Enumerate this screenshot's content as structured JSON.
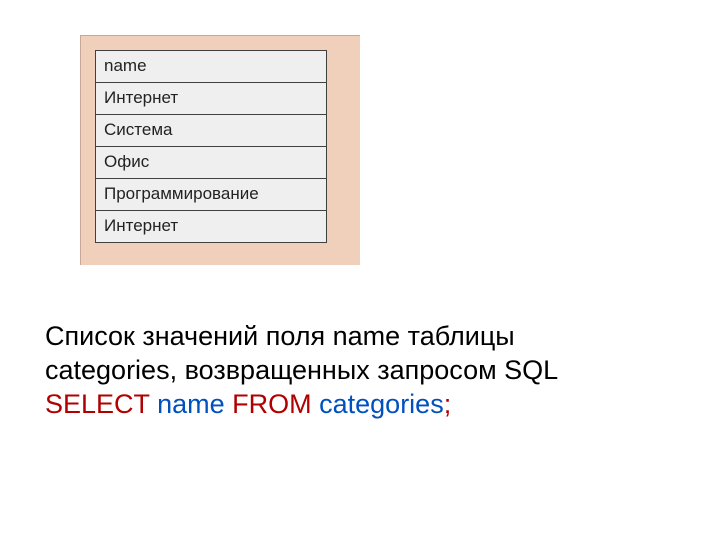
{
  "table": {
    "header": "name",
    "rows": [
      "Интернет",
      "Система",
      "Офис",
      "Программирование",
      "Интернет"
    ]
  },
  "caption": {
    "line1": "Список значений поля name таблицы",
    "line2": "categories, возвращенных запросом SQL"
  },
  "sql": {
    "kw_select": "SELECT",
    "col": "name",
    "kw_from": "FROM",
    "tbl": "categories",
    "terminator": ";"
  }
}
